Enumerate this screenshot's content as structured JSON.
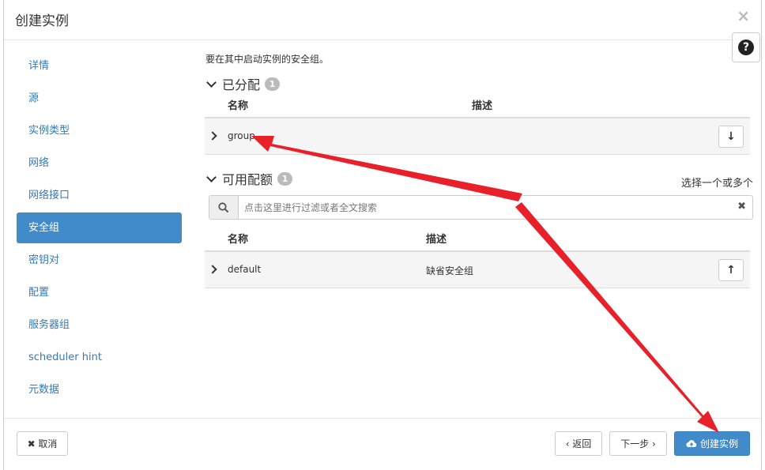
{
  "modal": {
    "title": "创建实例",
    "close_label": "×",
    "help_label": "?"
  },
  "nav": {
    "items": [
      {
        "label": "详情",
        "active": false
      },
      {
        "label": "源",
        "active": false
      },
      {
        "label": "实例类型",
        "active": false
      },
      {
        "label": "网络",
        "active": false
      },
      {
        "label": "网络接口",
        "active": false
      },
      {
        "label": "安全组",
        "active": true
      },
      {
        "label": "密钥对",
        "active": false
      },
      {
        "label": "配置",
        "active": false
      },
      {
        "label": "服务器组",
        "active": false
      },
      {
        "label": "scheduler hint",
        "active": false
      },
      {
        "label": "元数据",
        "active": false
      }
    ]
  },
  "content": {
    "intro": "要在其中启动实例的安全组。",
    "allocated": {
      "title": "已分配",
      "count": "1",
      "col_name": "名称",
      "col_desc": "描述",
      "rows": [
        {
          "name": "group",
          "desc": ""
        }
      ]
    },
    "available": {
      "title": "可用配额",
      "count": "1",
      "select_hint": "选择一个或多个",
      "search_placeholder": "点击这里进行过滤或者全文搜索",
      "col_name": "名称",
      "col_desc": "描述",
      "rows": [
        {
          "name": "default",
          "desc": "缺省安全组"
        }
      ]
    }
  },
  "footer": {
    "cancel_label": "✖ 取消",
    "back_label": "‹ 返回",
    "next_label": "下一步 ›",
    "create_label": "创建实例"
  },
  "colors": {
    "primary": "#428bca",
    "annotation_arrow": "#e8202a"
  }
}
